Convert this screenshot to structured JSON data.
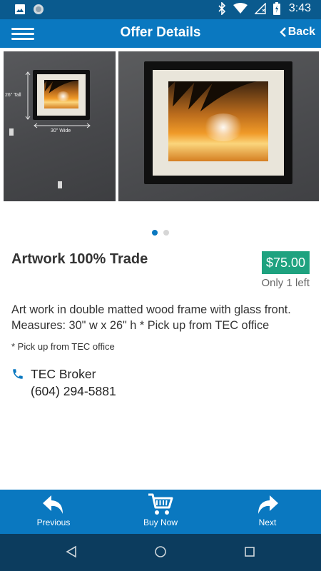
{
  "status_bar": {
    "time": "3:43",
    "icons": [
      "image-icon",
      "circle-icon",
      "bluetooth-icon",
      "wifi-icon",
      "signal-icon",
      "battery-icon"
    ]
  },
  "app_bar": {
    "title": "Offer Details",
    "back_label": "Back",
    "menu_icon": "hamburger-menu-icon"
  },
  "gallery": {
    "photo_1": {
      "height_label": "26\" Tall",
      "width_label": "30\" Wide"
    },
    "photo_count": 2,
    "active_index": 0
  },
  "offer": {
    "title": "Artwork 100% Trade",
    "price": "$75.00",
    "stock": "Only 1 left",
    "description": "Art work in double matted wood frame with glass front. Measures: 30\" w x 26\" h * Pick up from TEC office",
    "note": "* Pick up from TEC office"
  },
  "contact": {
    "name": "TEC Broker",
    "phone": "(604) 294-5881",
    "icon": "phone-icon"
  },
  "actions": {
    "previous": "Previous",
    "buy_now": "Buy Now",
    "next": "Next"
  },
  "colors": {
    "status_bar": "#0a5a8e",
    "app_bar": "#0a78c0",
    "price_badge": "#1ea27f",
    "nav_bar": "#0c3c5e"
  }
}
